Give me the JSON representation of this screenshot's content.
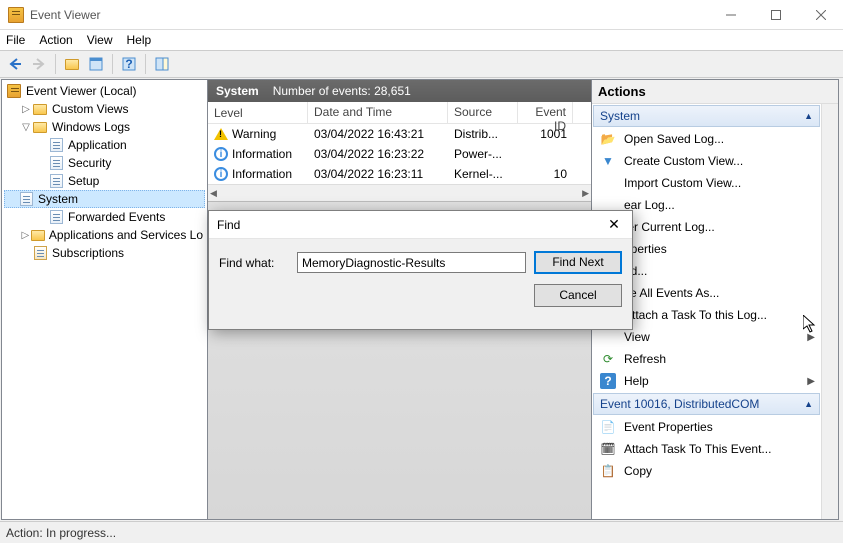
{
  "title": "Event Viewer",
  "menu": {
    "file": "File",
    "action": "Action",
    "view": "View",
    "help": "Help"
  },
  "tree": {
    "root": "Event Viewer (Local)",
    "custom": "Custom Views",
    "winlogs": "Windows Logs",
    "app": "Application",
    "security": "Security",
    "setup": "Setup",
    "system": "System",
    "forwarded": "Forwarded Events",
    "appsvc": "Applications and Services Lo",
    "subs": "Subscriptions"
  },
  "center": {
    "section": "System",
    "count_label": "Number of events: 28,651",
    "headers": {
      "level": "Level",
      "date": "Date and Time",
      "source": "Source",
      "id": "Event ID"
    },
    "rows": [
      {
        "level": "Warning",
        "date": "03/04/2022 16:43:21",
        "src": "Distrib...",
        "id": "1001"
      },
      {
        "level": "Information",
        "date": "03/04/2022 16:23:22",
        "src": "Power-...",
        "id": ""
      },
      {
        "level": "Information",
        "date": "03/04/2022 16:23:11",
        "src": "Kernel-...",
        "id": "10"
      }
    ]
  },
  "actions": {
    "title": "Actions",
    "section1": "System",
    "items1": {
      "open": "Open Saved Log...",
      "create": "Create Custom View...",
      "import": "Import Custom View...",
      "clear": "ear Log...",
      "filter": "ter Current Log...",
      "props": "operties",
      "find": "nd...",
      "saveas": "ve All Events As...",
      "attach": "Attach a Task To this Log...",
      "view": "View",
      "refresh": "Refresh",
      "help": "Help"
    },
    "section2": "Event 10016, DistributedCOM",
    "items2": {
      "evprops": "Event Properties",
      "evattach": "Attach Task To This Event...",
      "copy": "Copy"
    }
  },
  "find": {
    "title": "Find",
    "label": "Find what:",
    "value": "MemoryDiagnostic-Results",
    "next": "Find Next",
    "cancel": "Cancel"
  },
  "status": "Action:  In progress..."
}
